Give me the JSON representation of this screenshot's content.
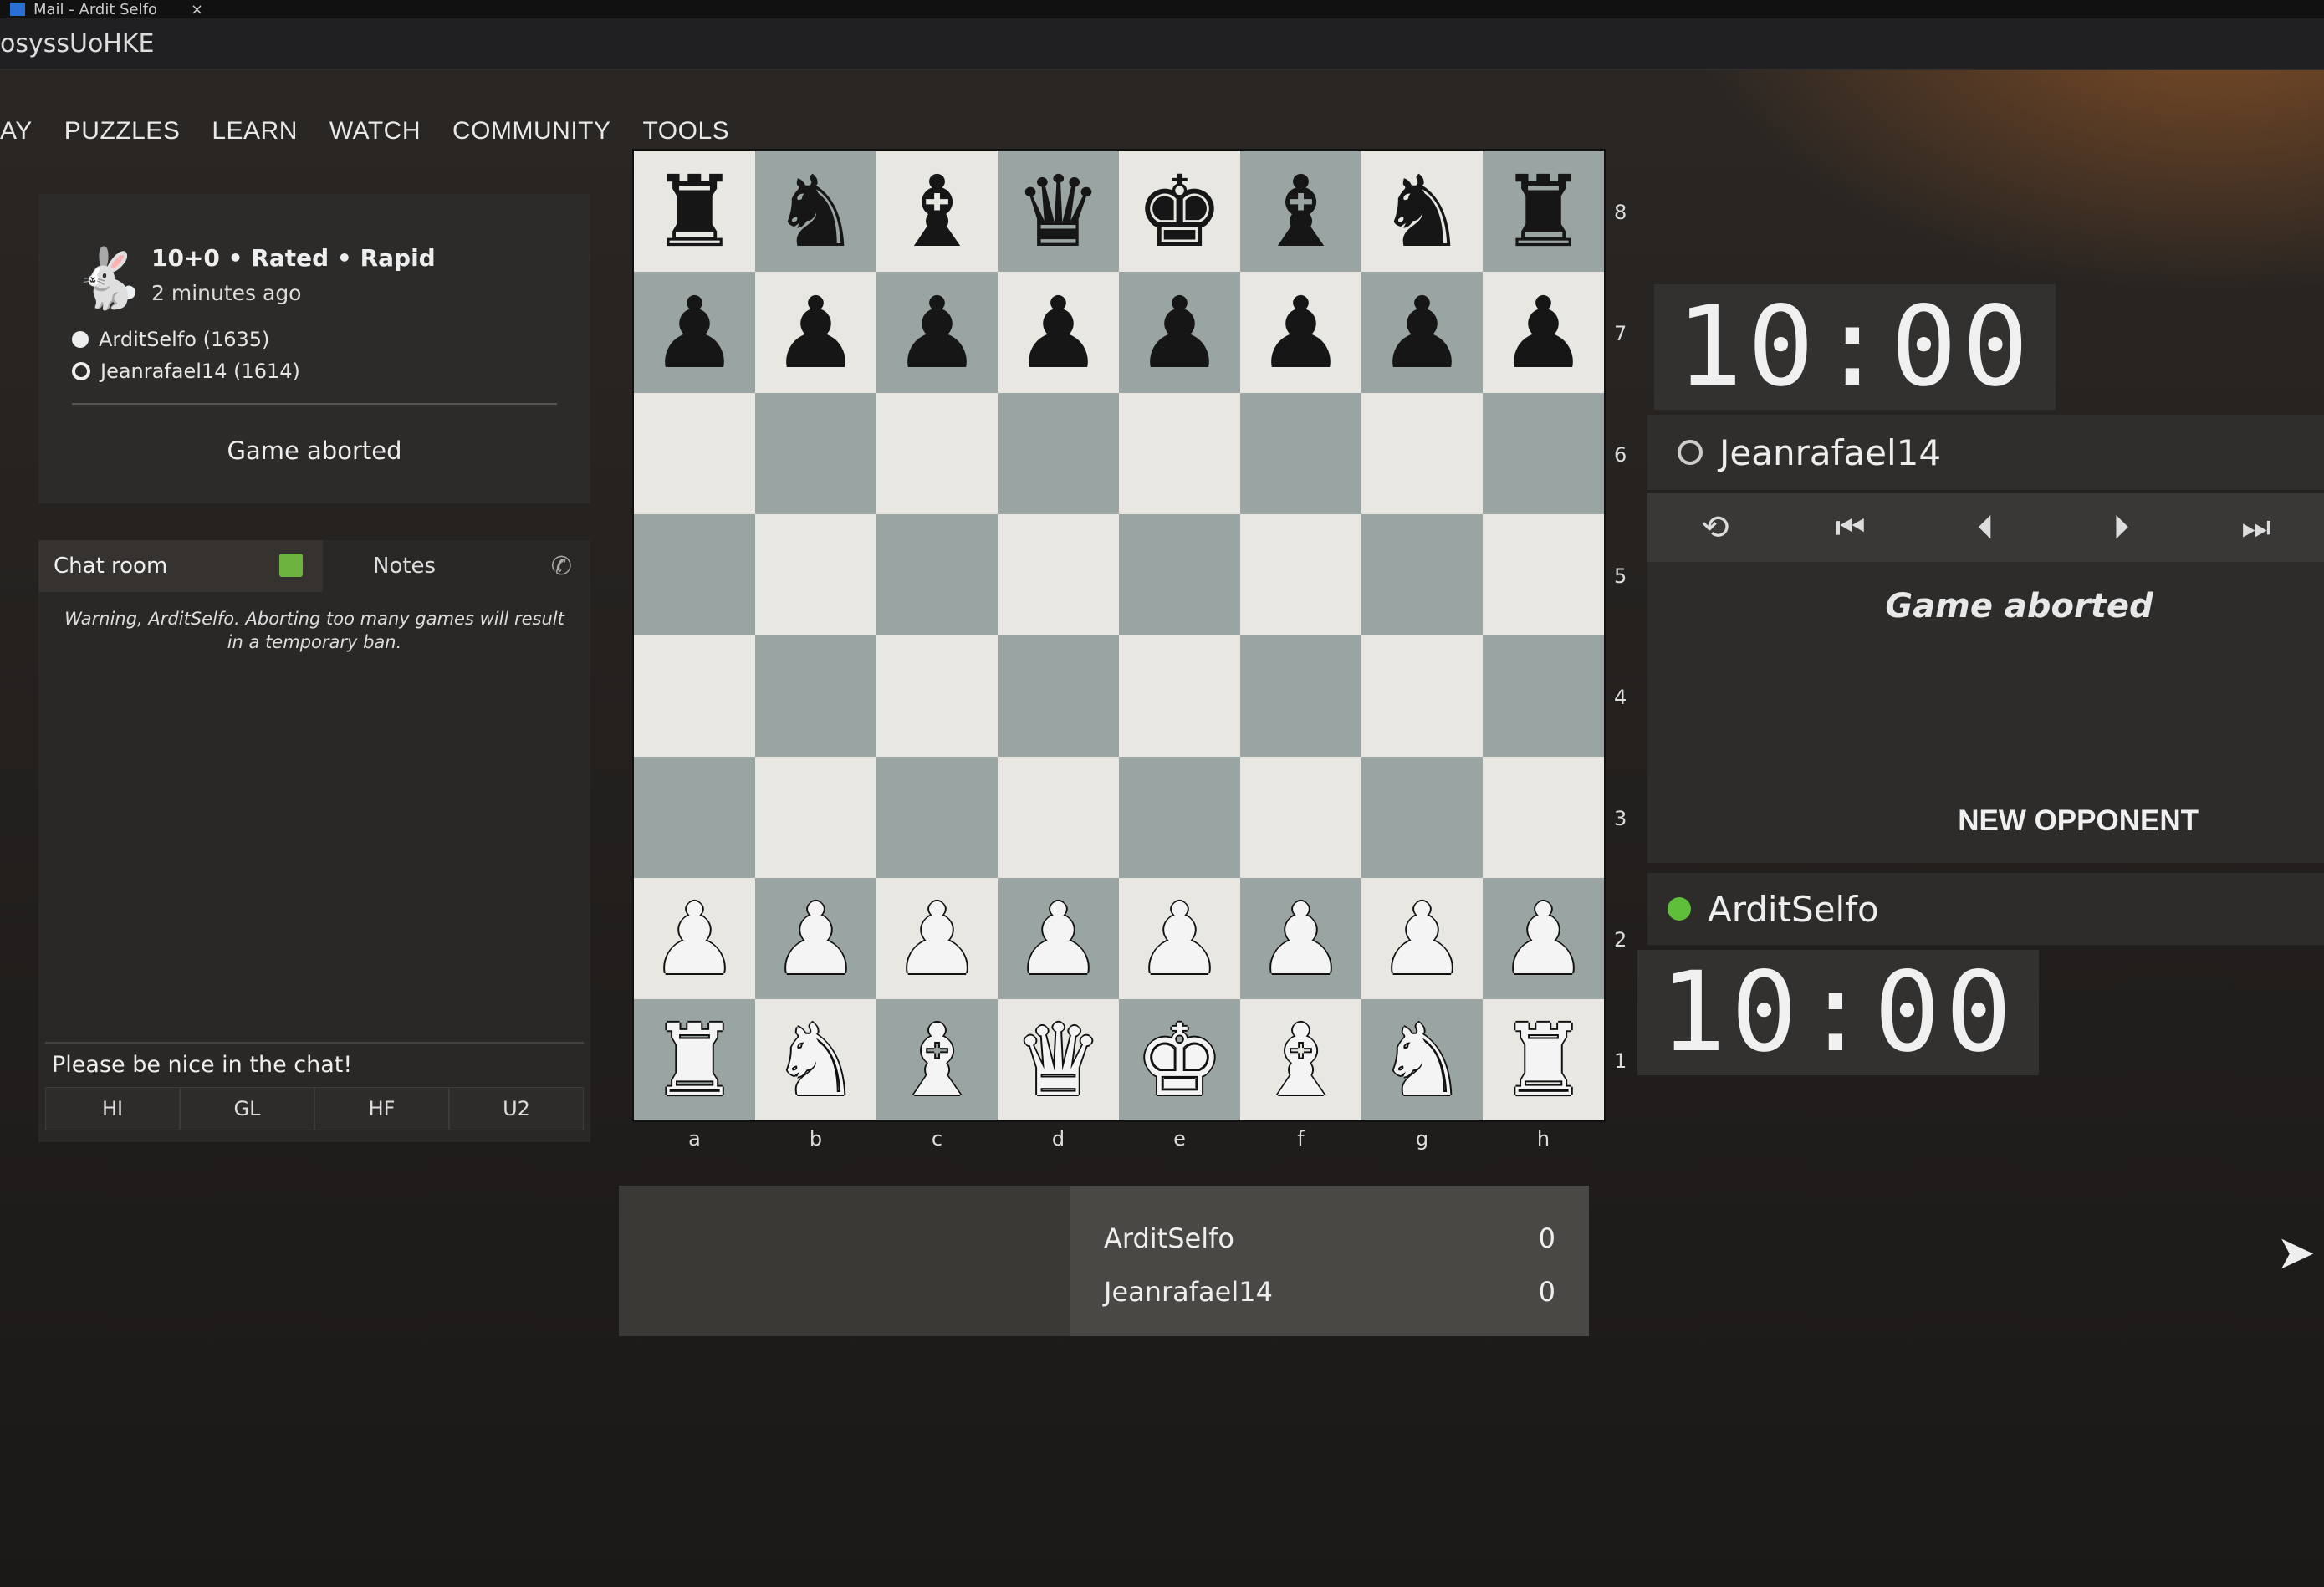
{
  "window": {
    "tab_title": "Mail - Ardit Selfo",
    "tab_close": "×",
    "url_fragment": "osyssUoHKE"
  },
  "nav": {
    "items": [
      "AY",
      "PUZZLES",
      "LEARN",
      "WATCH",
      "COMMUNITY",
      "TOOLS"
    ]
  },
  "game_info": {
    "icon": "rabbit-icon",
    "title": "10+0 • Rated • Rapid",
    "time_ago": "2 minutes ago",
    "white_player": "ArditSelfo (1635)",
    "black_player": "Jeanrafael14 (1614)",
    "status": "Game aborted"
  },
  "chat": {
    "tab_chat": "Chat room",
    "tab_notes": "Notes",
    "warning": "Warning, ArditSelfo. Aborting too many games will result in a temporary ban.",
    "input_placeholder": "Please be nice in the chat!",
    "quick_replies": [
      "HI",
      "GL",
      "HF",
      "U2"
    ]
  },
  "board": {
    "ranks": [
      "8",
      "7",
      "6",
      "5",
      "4",
      "3",
      "2",
      "1"
    ],
    "files": [
      "a",
      "b",
      "c",
      "d",
      "e",
      "f",
      "g",
      "h"
    ],
    "position": [
      [
        "br",
        "bn",
        "bb",
        "bq",
        "bk",
        "bb",
        "bn",
        "br"
      ],
      [
        "bp",
        "bp",
        "bp",
        "bp",
        "bp",
        "bp",
        "bp",
        "bp"
      ],
      [
        "",
        "",
        "",
        "",
        "",
        "",
        "",
        ""
      ],
      [
        "",
        "",
        "",
        "",
        "",
        "",
        "",
        ""
      ],
      [
        "",
        "",
        "",
        "",
        "",
        "",
        "",
        ""
      ],
      [
        "",
        "",
        "",
        "",
        "",
        "",
        "",
        ""
      ],
      [
        "wp",
        "wp",
        "wp",
        "wp",
        "wp",
        "wp",
        "wp",
        "wp"
      ],
      [
        "wr",
        "wn",
        "wb",
        "wq",
        "wk",
        "wb",
        "wn",
        "wr"
      ]
    ]
  },
  "score": {
    "rows": [
      {
        "player": "ArditSelfo",
        "points": "0"
      },
      {
        "player": "Jeanrafael14",
        "points": "0"
      }
    ]
  },
  "right": {
    "opponent_clock": "10:00",
    "opponent_name": "Jeanrafael14",
    "controls": [
      "flip-board-icon",
      "first-move-icon",
      "prev-move-icon",
      "next-move-icon",
      "last-move-icon"
    ],
    "status": "Game aborted",
    "new_opponent": "NEW OPPONENT",
    "player_name": "ArditSelfo",
    "player_clock": "10:00"
  }
}
